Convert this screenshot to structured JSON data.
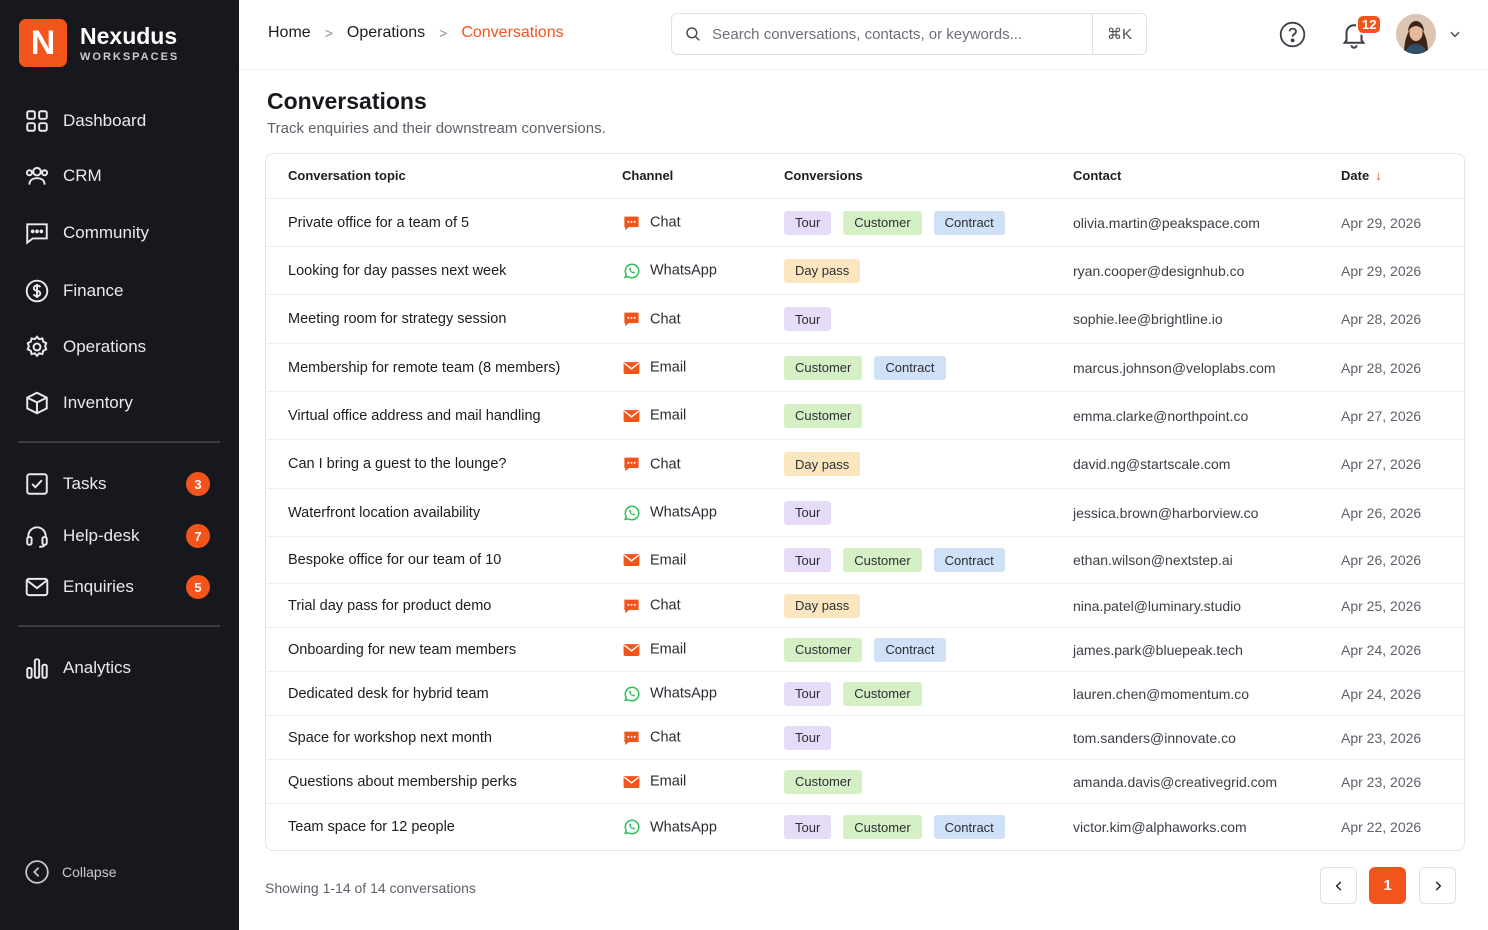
{
  "brand": {
    "logo_letter": "N",
    "name": "Nexudus",
    "sub": "WORKSPACES"
  },
  "sidebar": {
    "items": [
      {
        "label": "Dashboard",
        "icon": "grid-icon"
      },
      {
        "label": "CRM",
        "icon": "users-icon"
      },
      {
        "label": "Community",
        "icon": "message-square-icon"
      },
      {
        "label": "Finance",
        "icon": "dollar-circle-icon"
      },
      {
        "label": "Operations",
        "icon": "gear-icon"
      },
      {
        "label": "Inventory",
        "icon": "box-icon"
      },
      {
        "label": "Tasks",
        "icon": "checkbox-icon",
        "badge": "3"
      },
      {
        "label": "Help-desk",
        "icon": "headset-icon",
        "badge": "7"
      },
      {
        "label": "Enquiries",
        "icon": "mail-icon",
        "badge": "5"
      },
      {
        "label": "Analytics",
        "icon": "bar-chart-icon"
      }
    ],
    "collapse_label": "Collapse"
  },
  "header": {
    "breadcrumbs": [
      "Home",
      "Operations",
      "Conversations"
    ],
    "search_placeholder": "Search conversations, contacts, or keywords...",
    "search_shortcut": "⌘K",
    "notification_count": "12"
  },
  "page": {
    "title": "Conversations",
    "subtitle": "Track enquiries and their downstream conversions."
  },
  "table": {
    "columns": [
      "Conversation topic",
      "Channel",
      "Conversions",
      "Contact",
      "Date"
    ],
    "sort_indicator": "↓",
    "rows": [
      {
        "topic": "Private office for a team of 5",
        "channel": "Chat",
        "conversions": [
          "Tour",
          "Customer",
          "Contract"
        ],
        "contact": "olivia.martin@peakspace.com",
        "date": "Apr 29, 2026"
      },
      {
        "topic": "Looking for day passes next week",
        "channel": "WhatsApp",
        "conversions": [
          "Day pass"
        ],
        "contact": "ryan.cooper@designhub.co",
        "date": "Apr 29, 2026"
      },
      {
        "topic": "Meeting room for strategy session",
        "channel": "Chat",
        "conversions": [
          "Tour"
        ],
        "contact": "sophie.lee@brightline.io",
        "date": "Apr 28, 2026"
      },
      {
        "topic": "Membership for remote team (8 members)",
        "channel": "Email",
        "conversions": [
          "Customer",
          "Contract"
        ],
        "contact": "marcus.johnson@veloplabs.com",
        "date": "Apr 28, 2026"
      },
      {
        "topic": "Virtual office address and mail handling",
        "channel": "Email",
        "conversions": [
          "Customer"
        ],
        "contact": "emma.clarke@northpoint.co",
        "date": "Apr 27, 2026"
      },
      {
        "topic": "Can I bring a guest to the lounge?",
        "channel": "Chat",
        "conversions": [
          "Day pass"
        ],
        "contact": "david.ng@startscale.com",
        "date": "Apr 27, 2026"
      },
      {
        "topic": "Waterfront location availability",
        "channel": "WhatsApp",
        "conversions": [
          "Tour"
        ],
        "contact": "jessica.brown@harborview.co",
        "date": "Apr 26, 2026"
      },
      {
        "topic": "Bespoke office for our team of 10",
        "channel": "Email",
        "conversions": [
          "Tour",
          "Customer",
          "Contract"
        ],
        "contact": "ethan.wilson@nextstep.ai",
        "date": "Apr 26, 2026"
      },
      {
        "topic": "Trial day pass for product demo",
        "channel": "Chat",
        "conversions": [
          "Day pass"
        ],
        "contact": "nina.patel@luminary.studio",
        "date": "Apr 25, 2026"
      },
      {
        "topic": "Onboarding for new team members",
        "channel": "Email",
        "conversions": [
          "Customer",
          "Contract"
        ],
        "contact": "james.park@bluepeak.tech",
        "date": "Apr 24, 2026"
      },
      {
        "topic": "Dedicated desk for hybrid team",
        "channel": "WhatsApp",
        "conversions": [
          "Tour",
          "Customer"
        ],
        "contact": "lauren.chen@momentum.co",
        "date": "Apr 24, 2026"
      },
      {
        "topic": "Space for workshop next month",
        "channel": "Chat",
        "conversions": [
          "Tour"
        ],
        "contact": "tom.sanders@innovate.co",
        "date": "Apr 23, 2026"
      },
      {
        "topic": "Questions about membership perks",
        "channel": "Email",
        "conversions": [
          "Customer"
        ],
        "contact": "amanda.davis@creativegrid.com",
        "date": "Apr 23, 2026"
      },
      {
        "topic": "Team space for 12 people",
        "channel": "WhatsApp",
        "conversions": [
          "Tour",
          "Customer",
          "Contract"
        ],
        "contact": "victor.kim@alphaworks.com",
        "date": "Apr 22, 2026"
      }
    ]
  },
  "footer": {
    "summary": "Showing 1-14 of 14 conversations"
  },
  "pagination": {
    "current": "1",
    "prev_icon": "chevron-left-icon",
    "next_icon": "chevron-right-icon"
  },
  "colors": {
    "accent": "#f2541b",
    "sidebar_bg": "#17181d",
    "chat": "#f2541b",
    "whatsapp": "#2fbf5b",
    "email": "#f2541b",
    "tag_tour": "#e6dcf7",
    "tag_customer": "#d6f0c6",
    "tag_contract": "#cfe0f7",
    "tag_daypass": "#fbe6bf"
  }
}
